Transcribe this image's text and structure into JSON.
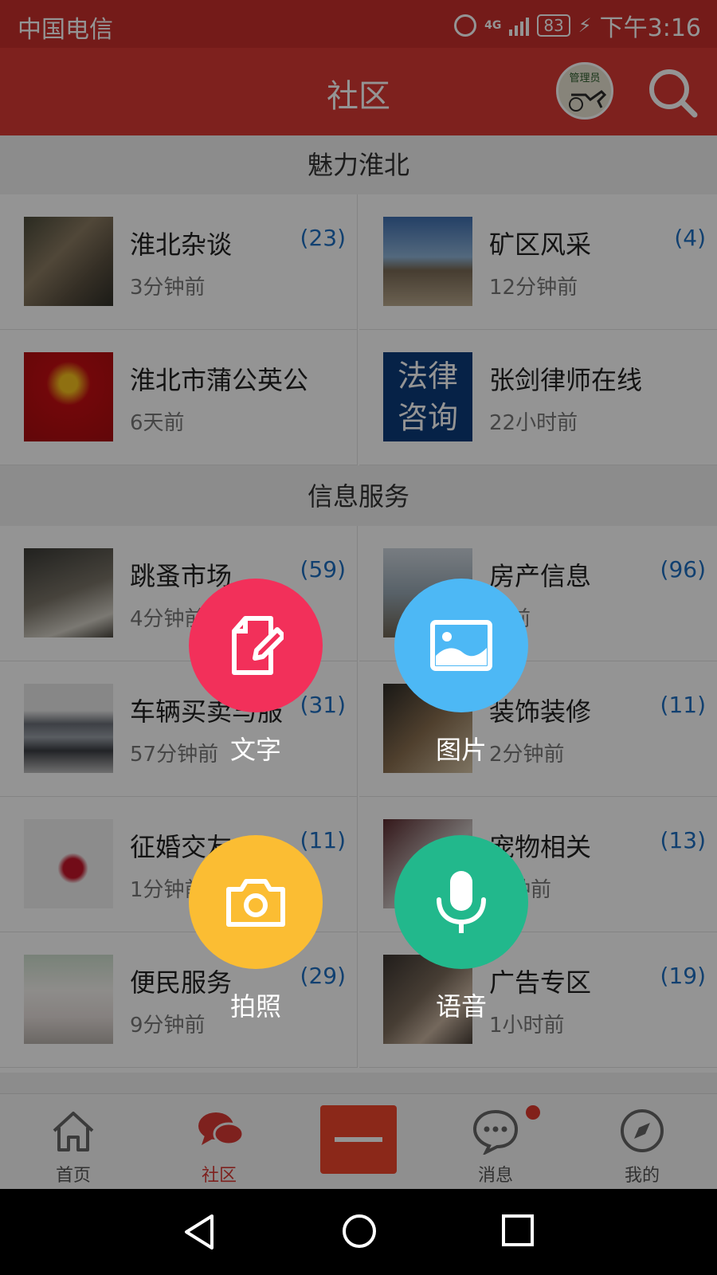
{
  "status_bar": {
    "carrier": "中国电信",
    "network": "4G",
    "battery": "83",
    "time": "下午3:16"
  },
  "header": {
    "title": "社区",
    "admin_badge": "管理员"
  },
  "sections": [
    {
      "title": "魅力淮北",
      "items": [
        {
          "name": "淮北杂谈",
          "time": "3分钟前",
          "count": "(23)"
        },
        {
          "name": "矿区风采",
          "time": "12分钟前",
          "count": "(4)"
        },
        {
          "name": "淮北市蒲公英公",
          "time": "6天前",
          "count": ""
        },
        {
          "name": "张剑律师在线",
          "time": "22小时前",
          "count": "",
          "thumb_text": [
            "法律",
            "咨询"
          ]
        }
      ]
    },
    {
      "title": "信息服务",
      "items": [
        {
          "name": "跳蚤市场",
          "time": "4分钟前",
          "count": "(59)"
        },
        {
          "name": "房产信息",
          "time": "钟前",
          "count": "(96)"
        },
        {
          "name": "车辆买卖与服",
          "time": "57分钟前",
          "count": "(31)"
        },
        {
          "name": "装饰装修",
          "time": "2分钟前",
          "count": "(11)"
        },
        {
          "name": "征婚交友",
          "time": "1分钟前",
          "count": "(11)"
        },
        {
          "name": "宠物相关",
          "time": "分钟前",
          "count": "(13)"
        },
        {
          "name": "便民服务",
          "time": "9分钟前",
          "count": "(29)"
        },
        {
          "name": "广告专区",
          "time": "1小时前",
          "count": "(19)"
        }
      ]
    }
  ],
  "actions": {
    "text": {
      "label": "文字",
      "color": "#f2305a"
    },
    "image": {
      "label": "图片",
      "color": "#4db8f5"
    },
    "photo": {
      "label": "拍照",
      "color": "#fbbd33"
    },
    "voice": {
      "label": "语音",
      "color": "#22b88c"
    }
  },
  "bottom_nav": [
    {
      "label": "首页",
      "icon": "home-icon"
    },
    {
      "label": "社区",
      "icon": "chat-bubbles-icon",
      "active": true
    },
    {
      "label": "",
      "icon": "minus-icon"
    },
    {
      "label": "消息",
      "icon": "message-icon",
      "badge": true
    },
    {
      "label": "我的",
      "icon": "compass-icon"
    }
  ],
  "colors": {
    "brand": "#d93a34",
    "count": "#1e6fc2"
  }
}
